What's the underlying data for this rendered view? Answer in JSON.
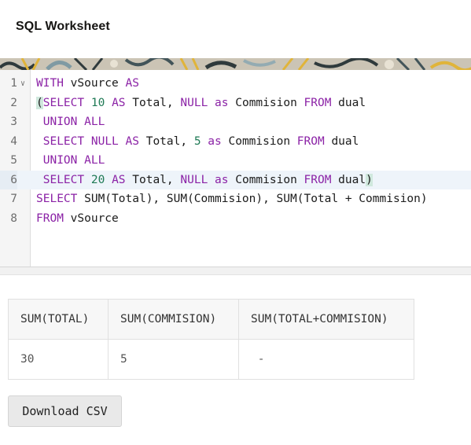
{
  "header": {
    "title": "SQL Worksheet"
  },
  "editor": {
    "line_numbers": [
      "1",
      "2",
      "3",
      "4",
      "5",
      "6",
      "7",
      "8"
    ],
    "lines": [
      [
        {
          "t": "kw",
          "v": "WITH"
        },
        {
          "t": "tx",
          "v": " vSource "
        },
        {
          "t": "kw",
          "v": "AS"
        }
      ],
      [
        {
          "t": "br",
          "v": "("
        },
        {
          "t": "kw",
          "v": "SELECT"
        },
        {
          "t": "tx",
          "v": " "
        },
        {
          "t": "num",
          "v": "10"
        },
        {
          "t": "tx",
          "v": " "
        },
        {
          "t": "kw",
          "v": "AS"
        },
        {
          "t": "tx",
          "v": " Total, "
        },
        {
          "t": "kw",
          "v": "NULL"
        },
        {
          "t": "tx",
          "v": " "
        },
        {
          "t": "kw",
          "v": "as"
        },
        {
          "t": "tx",
          "v": " Commision "
        },
        {
          "t": "kw",
          "v": "FROM"
        },
        {
          "t": "tx",
          "v": " dual"
        }
      ],
      [
        {
          "t": "tx",
          "v": " "
        },
        {
          "t": "kw",
          "v": "UNION ALL"
        }
      ],
      [
        {
          "t": "tx",
          "v": " "
        },
        {
          "t": "kw",
          "v": "SELECT"
        },
        {
          "t": "tx",
          "v": " "
        },
        {
          "t": "kw",
          "v": "NULL"
        },
        {
          "t": "tx",
          "v": " "
        },
        {
          "t": "kw",
          "v": "AS"
        },
        {
          "t": "tx",
          "v": " Total, "
        },
        {
          "t": "num",
          "v": "5"
        },
        {
          "t": "tx",
          "v": " "
        },
        {
          "t": "kw",
          "v": "as"
        },
        {
          "t": "tx",
          "v": " Commision "
        },
        {
          "t": "kw",
          "v": "FROM"
        },
        {
          "t": "tx",
          "v": " dual"
        }
      ],
      [
        {
          "t": "tx",
          "v": " "
        },
        {
          "t": "kw",
          "v": "UNION ALL"
        }
      ],
      [
        {
          "t": "tx",
          "v": " "
        },
        {
          "t": "kw",
          "v": "SELECT"
        },
        {
          "t": "tx",
          "v": " "
        },
        {
          "t": "num",
          "v": "20"
        },
        {
          "t": "tx",
          "v": " "
        },
        {
          "t": "kw",
          "v": "AS"
        },
        {
          "t": "tx",
          "v": " Total, "
        },
        {
          "t": "kw",
          "v": "NULL"
        },
        {
          "t": "tx",
          "v": " "
        },
        {
          "t": "kw",
          "v": "as"
        },
        {
          "t": "tx",
          "v": " Commision "
        },
        {
          "t": "kw",
          "v": "FROM"
        },
        {
          "t": "tx",
          "v": " dual"
        },
        {
          "t": "br",
          "v": ")"
        }
      ],
      [
        {
          "t": "kw",
          "v": "SELECT"
        },
        {
          "t": "tx",
          "v": " SUM(Total), SUM(Commision), SUM(Total + Commision)"
        }
      ],
      [
        {
          "t": "kw",
          "v": "FROM"
        },
        {
          "t": "tx",
          "v": " vSource"
        }
      ]
    ],
    "active_line": 6,
    "fold_icon": "chevron-down-icon"
  },
  "results": {
    "columns": [
      "SUM(TOTAL)",
      "SUM(COMMISION)",
      "SUM(TOTAL+COMMISION)"
    ],
    "rows": [
      [
        "30",
        "5",
        " -"
      ]
    ]
  },
  "actions": {
    "download_label": "Download CSV"
  },
  "colors": {
    "keyword": "#8b22a6",
    "number": "#1f7a55",
    "active_line": "#eef4fa",
    "bracket_match": "#cfe8dd"
  }
}
